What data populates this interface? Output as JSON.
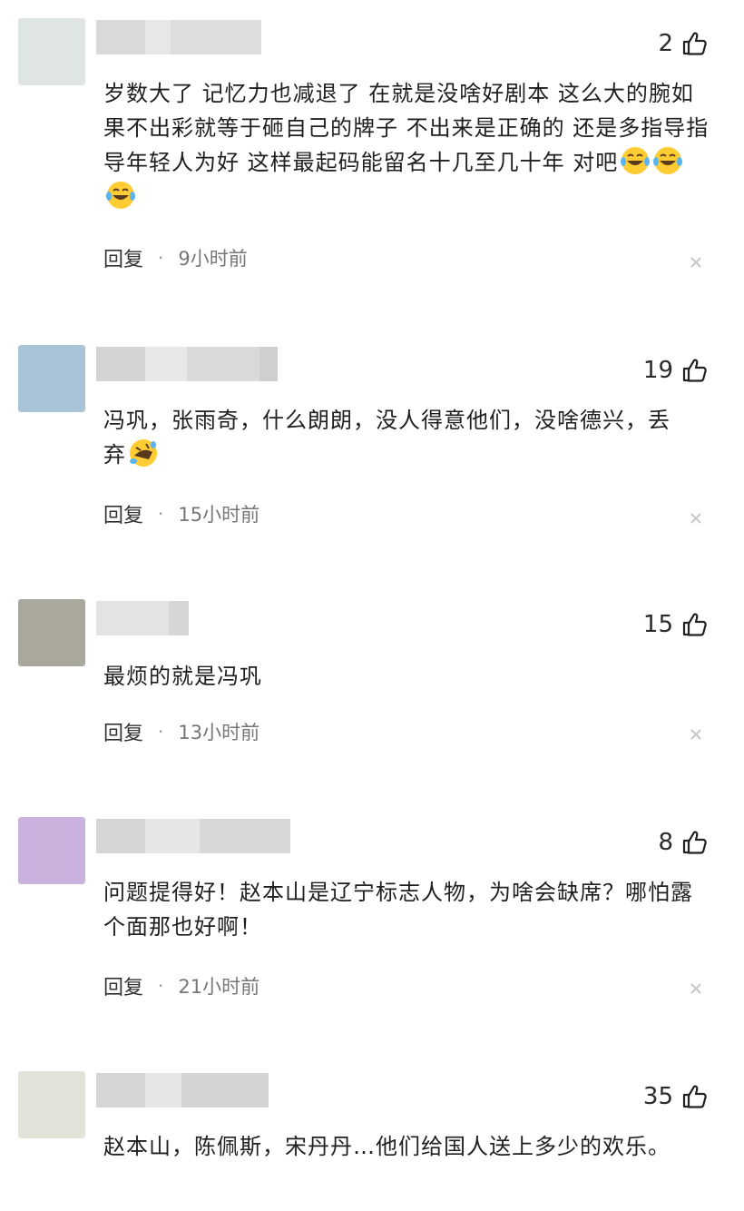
{
  "ui": {
    "reply_label": "回复",
    "dot": "·"
  },
  "comments": [
    {
      "likes": "2",
      "text": "岁数大了 记忆力也减退了 在就是没啥好剧本 这么大的腕如果不出彩就等于砸自己的牌子 不出来是正确的 还是多指导指导年轻人为好 这样最起码能留名十几至几十年 对吧",
      "emoji": [
        "face-with-tears-of-joy",
        "face-with-tears-of-joy",
        "face-with-tears-of-joy"
      ],
      "time": "9小时前",
      "avatar_color": "#dfe5e0"
    },
    {
      "likes": "19",
      "text": "冯巩，张雨奇，什么朗朗，没人得意他们，没啥德兴，丢弃",
      "emoji": [
        "rolling-on-floor-laughing"
      ],
      "time": "15小时前",
      "avatar_color": "#a9c4d6"
    },
    {
      "likes": "15",
      "text": "最烦的就是冯巩",
      "emoji": [],
      "time": "13小时前",
      "avatar_color": "#aaa89c"
    },
    {
      "likes": "8",
      "text": "问题提得好！赵本山是辽宁标志人物，为啥会缺席？哪怕露个面那也好啊！",
      "emoji": [],
      "time": "21小时前",
      "avatar_color": "#c9b3de"
    },
    {
      "likes": "35",
      "text": "赵本山，陈佩斯，宋丹丹…他们给国人送上多少的欢乐。",
      "emoji": [],
      "time": "",
      "avatar_color": "#e3e3da"
    }
  ]
}
